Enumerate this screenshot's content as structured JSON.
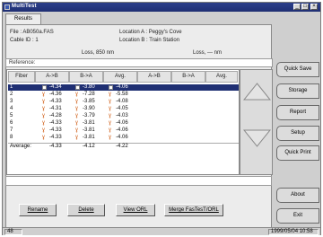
{
  "window": {
    "title": "MultiTest",
    "min_glyph": "_",
    "max_glyph": "□",
    "close_glyph": "×"
  },
  "tabs": {
    "results": "Results"
  },
  "info": {
    "file": "File : AB050a.FAS",
    "cable": "Cable ID : 1",
    "location_a": "Location A : Peggy's Cove",
    "location_b": "Location B : Train Station",
    "loss_left": "Loss, 850 nm",
    "loss_right": "Loss, --- nm"
  },
  "reference": {
    "label": "Reference:"
  },
  "table": {
    "headers": [
      "Fiber",
      "A->B",
      "B->A",
      "Avg.",
      "A->B",
      "B->A",
      "Avg."
    ],
    "rows": [
      {
        "fiber": "1",
        "ab": "-4.34",
        "ba": "-3.80",
        "avg": "-4.06",
        "selected": true,
        "mark": "box"
      },
      {
        "fiber": "2",
        "ab": "-4.36",
        "ba": "-7.28",
        "avg": "-5.58",
        "selected": false,
        "mark": "tri"
      },
      {
        "fiber": "3",
        "ab": "-4.33",
        "ba": "-3.85",
        "avg": "-4.08",
        "selected": false,
        "mark": "tri"
      },
      {
        "fiber": "4",
        "ab": "-4.31",
        "ba": "-3.90",
        "avg": "-4.05",
        "selected": false,
        "mark": "tri"
      },
      {
        "fiber": "5",
        "ab": "-4.28",
        "ba": "-3.79",
        "avg": "-4.03",
        "selected": false,
        "mark": "tri"
      },
      {
        "fiber": "6",
        "ab": "-4.33",
        "ba": "-3.81",
        "avg": "-4.06",
        "selected": false,
        "mark": "tri"
      },
      {
        "fiber": "7",
        "ab": "-4.33",
        "ba": "-3.81",
        "avg": "-4.06",
        "selected": false,
        "mark": "tri"
      },
      {
        "fiber": "8",
        "ab": "-4.33",
        "ba": "-3.81",
        "avg": "-4.06",
        "selected": false,
        "mark": "tri"
      }
    ],
    "average": {
      "label": "Average:",
      "ab": "-4.33",
      "ba": "-4.12",
      "avg": "-4.22"
    },
    "marker_glyph": "ɣ"
  },
  "buttons": {
    "rename": "Rename",
    "delete": "Delete",
    "view_orl": "View ORL",
    "merge": "Merge FasTesT/ORL"
  },
  "side_buttons": {
    "quick_save": "Quick Save",
    "storage": "Storage",
    "report": "Report",
    "setup": "Setup",
    "quick_print": "Quick Print",
    "about": "About",
    "exit": "Exit"
  },
  "statusbar": {
    "left": "48",
    "datetime": "1999/05/04 10:58"
  },
  "colors": {
    "titlebar": "#1f2f73",
    "selection": "#1f2f73",
    "marker_fail": "#d0601a"
  }
}
